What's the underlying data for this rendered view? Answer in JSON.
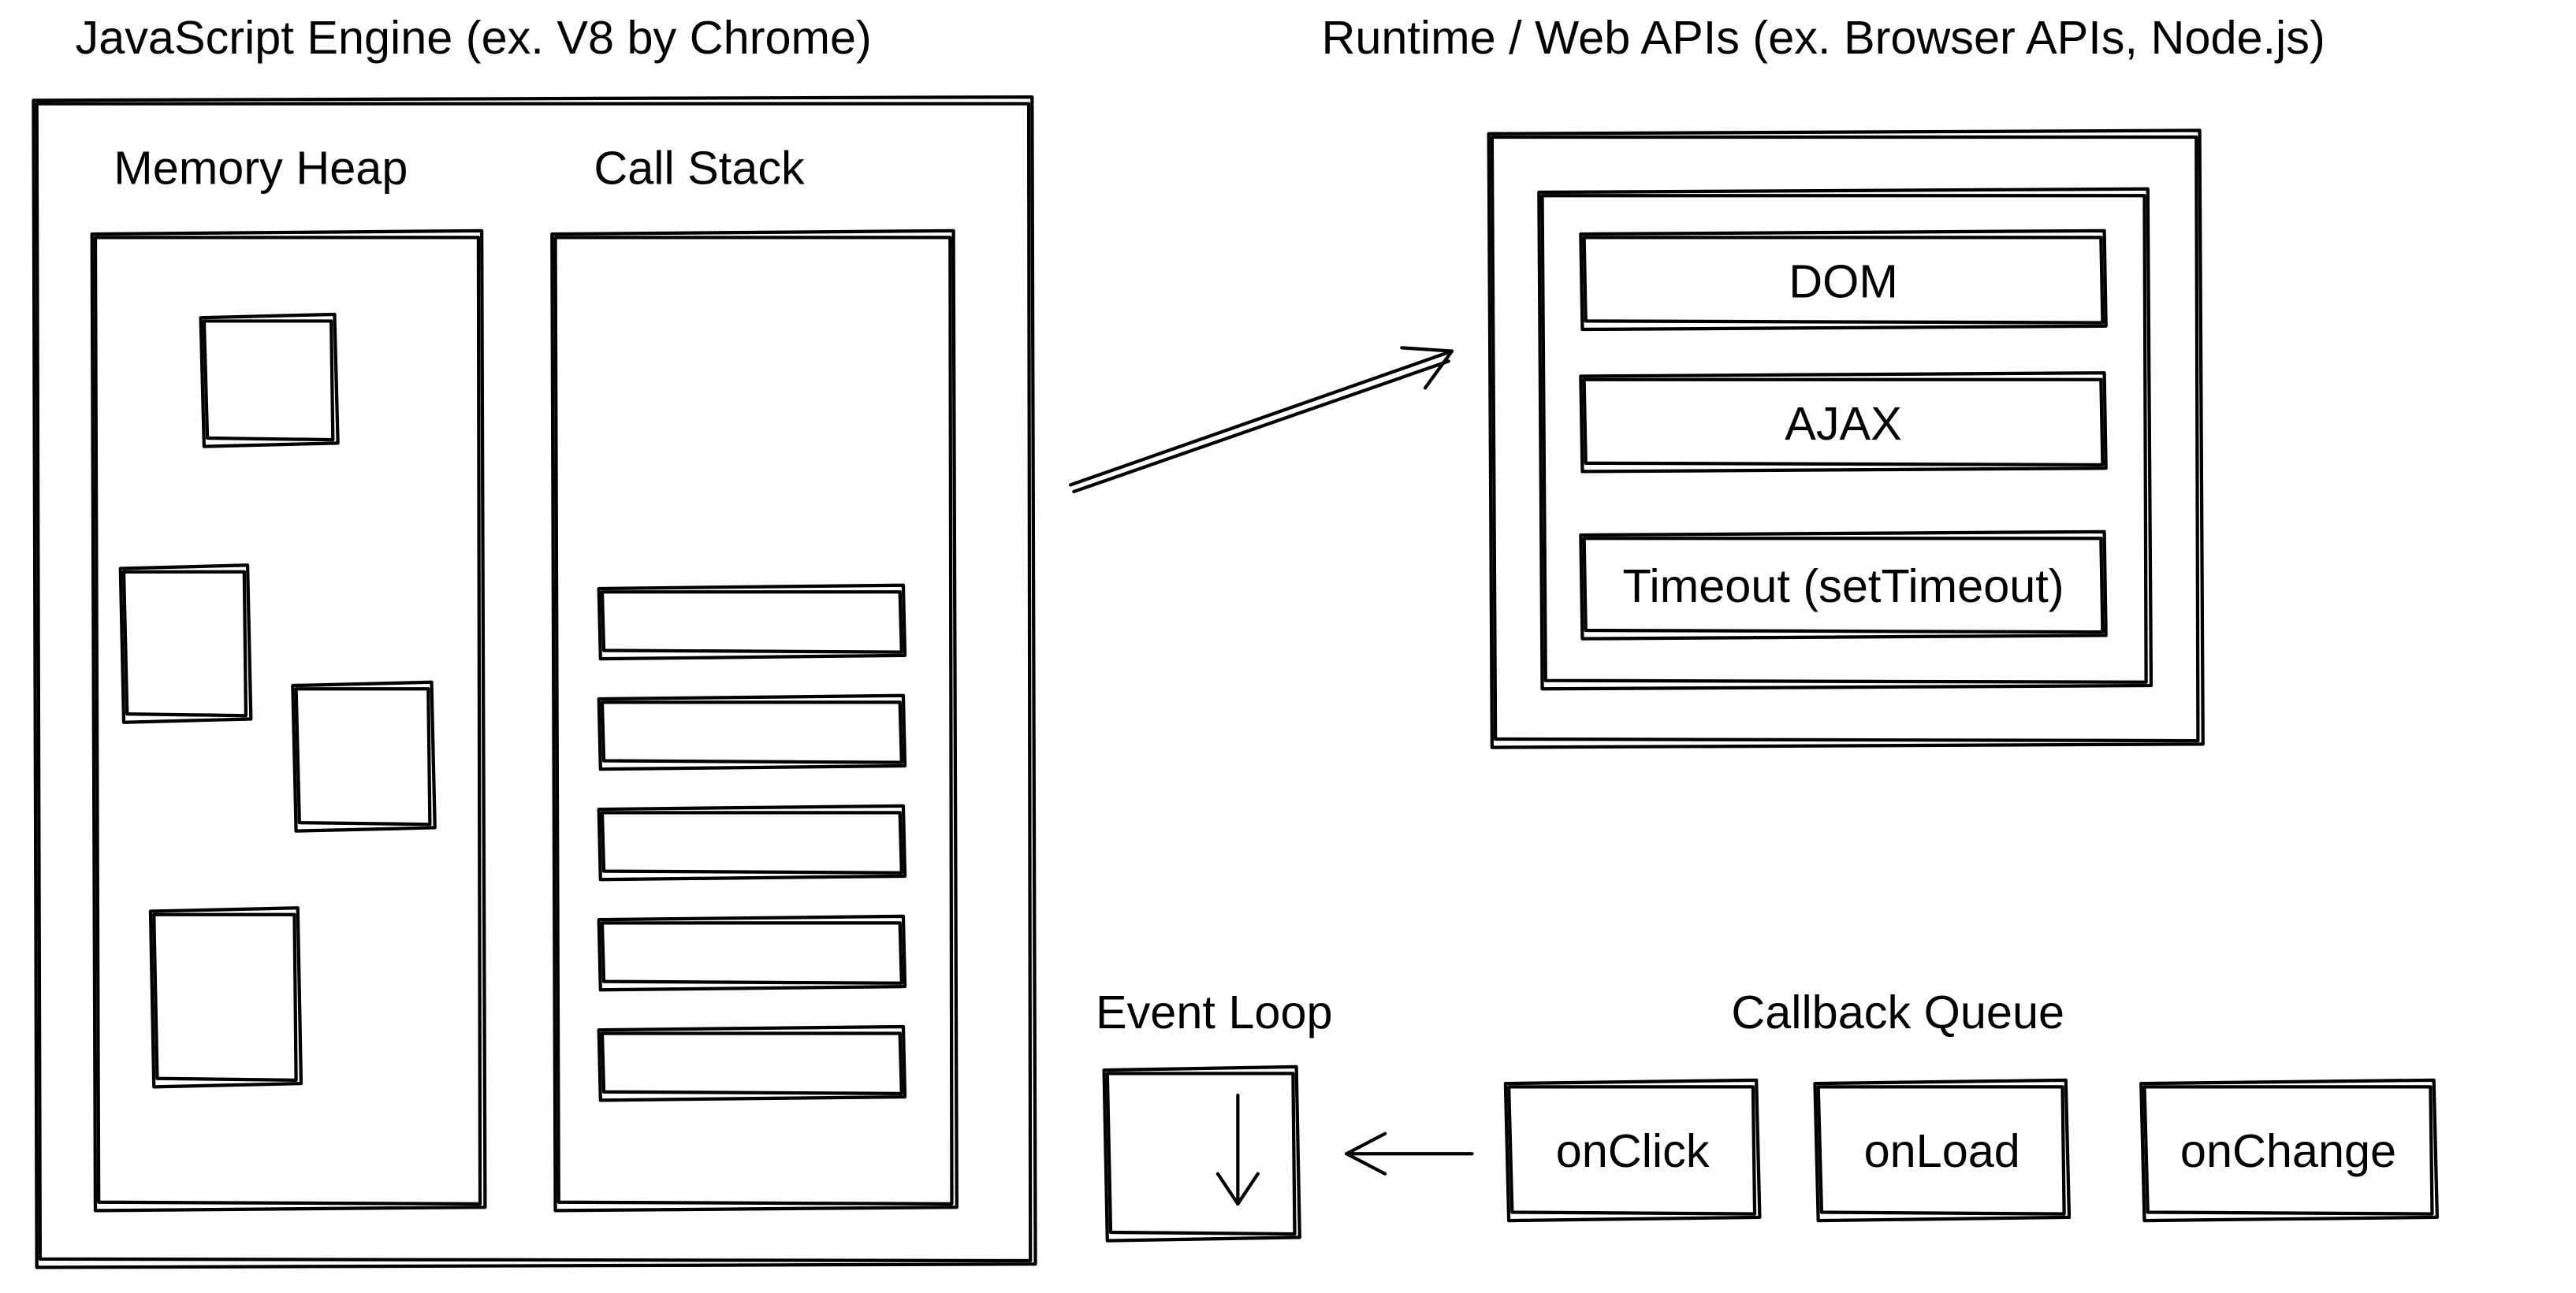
{
  "engine": {
    "title": "JavaScript Engine (ex. V8 by Chrome)",
    "memory_heap_label": "Memory Heap",
    "call_stack_label": "Call Stack"
  },
  "runtime": {
    "title": "Runtime / Web APIs (ex. Browser APIs, Node.js)",
    "items": [
      "DOM",
      "AJAX",
      "Timeout (setTimeout)"
    ]
  },
  "event_loop": {
    "label": "Event Loop"
  },
  "callback_queue": {
    "label": "Callback Queue",
    "items": [
      "onClick",
      "onLoad",
      "onChange"
    ]
  }
}
